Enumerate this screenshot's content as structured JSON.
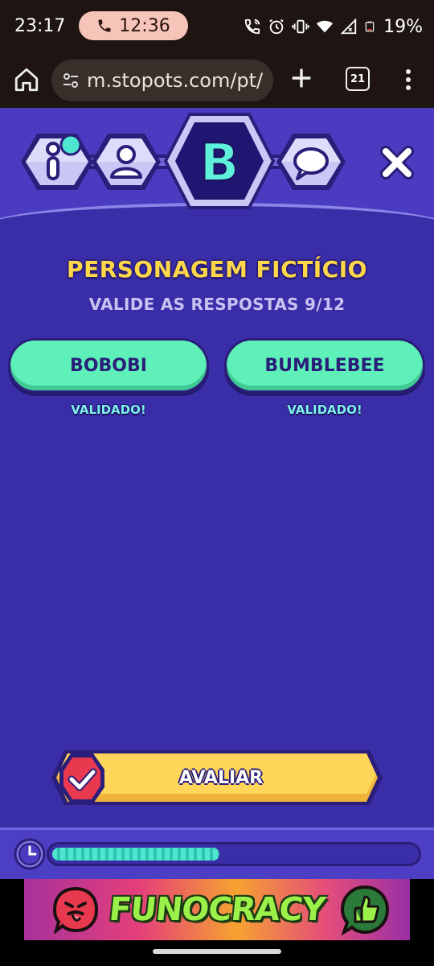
{
  "status_bar": {
    "time": "23:17",
    "call_timer": "12:36",
    "battery": "19%"
  },
  "browser": {
    "url": "m.stopots.com/pt/",
    "tab_count": "21"
  },
  "nav": {
    "active_letter": "B",
    "items": [
      "info-icon",
      "profile-icon",
      "letter-badge",
      "chat-icon"
    ]
  },
  "round": {
    "category": "PERSONAGEM FICTÍCIO",
    "instruction": "VALIDE AS RESPOSTAS 9/12"
  },
  "answers": [
    {
      "text": "BOBOBI",
      "status": "VALIDADO!"
    },
    {
      "text": "BUMBLEBEE",
      "status": "VALIDADO!"
    }
  ],
  "action": {
    "label": "AVALIAR"
  },
  "timer": {
    "progress": 0.46
  },
  "ad": {
    "brand": "FUNOCRACY"
  },
  "colors": {
    "background": "#3a2da8",
    "header": "#4b3bc0",
    "title": "#ffd84a",
    "answer": "#5ef0b8",
    "button": "#ffd65a",
    "accent_dark": "#2a1e7a"
  }
}
